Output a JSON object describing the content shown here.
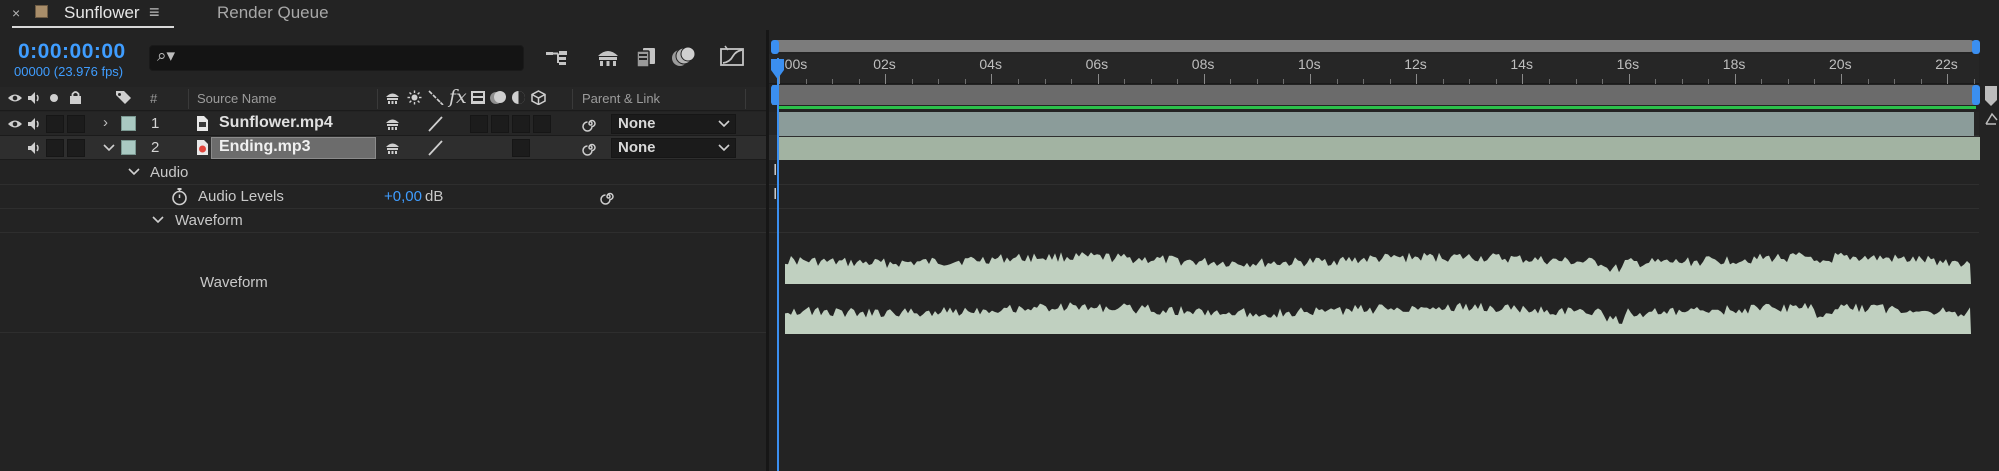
{
  "tabs": {
    "close_glyph": "×",
    "active_title": "Sunflower",
    "menu_glyph": "≡",
    "inactive_title": "Render Queue",
    "swatch_color": "#a98e6a"
  },
  "timecode": {
    "value": "0:00:00:00",
    "frames_fps": "00000 (23.976 fps)",
    "search_glyph": "⌕▾",
    "search_placeholder": ""
  },
  "columns": {
    "label_col": "#",
    "source_name": "Source Name",
    "parent_link": "Parent & Link",
    "fx_glyph": "fx"
  },
  "layers": [
    {
      "num": "1",
      "name": "Sunflower.mp4",
      "parent": "None",
      "label_color": "#a9c9c2"
    },
    {
      "num": "2",
      "name": "Ending.mp3",
      "parent": "None",
      "label_color": "#a9c9c2"
    }
  ],
  "properties": {
    "audio": "Audio",
    "audio_levels": "Audio Levels",
    "audio_levels_num": "+0,00",
    "audio_levels_unit": "dB",
    "waveform_group": "Waveform",
    "waveform_prop": "Waveform"
  },
  "ruler": {
    "labels": [
      "0:00s",
      "02s",
      "04s",
      "06s",
      "08s",
      "10s",
      "12s",
      "14s",
      "16s",
      "18s",
      "20s",
      "22s"
    ]
  },
  "colors": {
    "accent": "#3f9dff",
    "playhead": "#3b8ff0",
    "green_bar": "#2cc14b",
    "video_bar": "#8b9c9a",
    "audio_bar": "#a2b3a2",
    "waveform": "#c0d0c0"
  },
  "icons": [
    "close-icon",
    "menu-icon",
    "search-icon",
    "composition-flowchart-icon",
    "draft-3d-icon",
    "shy-layers-icon",
    "frame-blending-icon",
    "motion-blur-icon",
    "graph-editor-icon",
    "eye-icon",
    "audio-icon",
    "solo-icon",
    "lock-icon",
    "label-icon",
    "shy-icon",
    "collapse-icon",
    "quality-icon",
    "effects-icon",
    "frame-blend-icon",
    "motion-blur-column-icon",
    "adjustment-icon",
    "3d-layer-icon",
    "pickwhip-icon",
    "chevron-right-icon",
    "chevron-down-icon",
    "stopwatch-icon",
    "video-file-icon",
    "audio-file-icon",
    "playhead-icon"
  ]
}
